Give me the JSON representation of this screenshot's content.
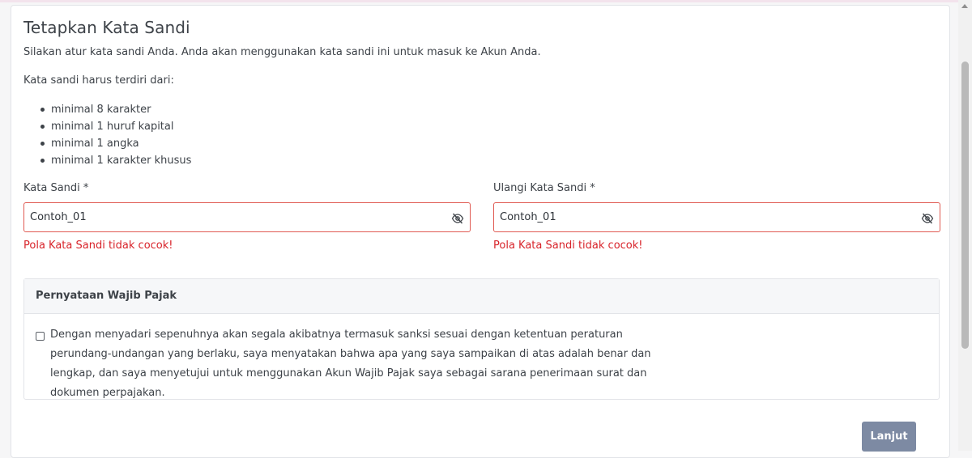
{
  "page": {
    "title": "Tetapkan Kata Sandi",
    "subtitle": "Silakan atur kata sandi Anda. Anda akan menggunakan kata sandi ini untuk masuk ke Akun Anda.",
    "requirements_intro": "Kata sandi harus terdiri dari:",
    "requirements": [
      "minimal 8 karakter",
      "minimal 1 huruf kapital",
      "minimal 1 angka",
      "minimal 1 karakter khusus"
    ]
  },
  "password": {
    "label": "Kata Sandi *",
    "value": "Contoh_01",
    "error": "Pola Kata Sandi tidak cocok!",
    "toggle_icon": "eye-slash-icon"
  },
  "confirm_password": {
    "label": "Ulangi Kata Sandi *",
    "value": "Contoh_01",
    "error": "Pola Kata Sandi tidak cocok!",
    "toggle_icon": "eye-slash-icon"
  },
  "statement": {
    "title": "Pernyataan Wajib Pajak",
    "checked": false,
    "text": "Dengan menyadari sepenuhnya akan segala akibatnya termasuk sanksi sesuai dengan ketentuan peraturan perundang-undangan yang berlaku, saya menyatakan bahwa apa yang saya sampaikan di atas adalah benar dan lengkap, dan saya menyetujui untuk menggunakan Akun Wajib Pajak saya sebagai sarana penerimaan surat dan dokumen perpajakan."
  },
  "actions": {
    "next_label": "Lanjut"
  },
  "colors": {
    "error": "#d8232a",
    "input_border_error": "#e05a52",
    "button": "#7d8aa3"
  }
}
